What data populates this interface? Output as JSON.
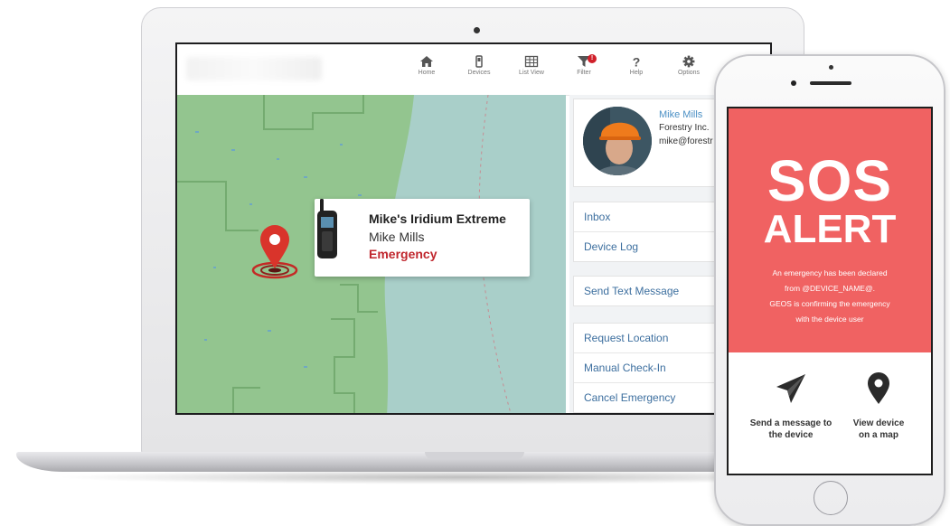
{
  "nav": {
    "items": [
      {
        "label": "Home",
        "icon": "home-icon"
      },
      {
        "label": "Devices",
        "icon": "device-icon"
      },
      {
        "label": "List View",
        "icon": "list-view-icon"
      },
      {
        "label": "Filter",
        "icon": "filter-icon"
      },
      {
        "label": "Help",
        "icon": "help-icon"
      },
      {
        "label": "Options",
        "icon": "gear-icon"
      }
    ],
    "filter_badge": "!"
  },
  "map_popup": {
    "device_name": "Mike's Iridium Extreme",
    "user_name": "Mike Mills",
    "status": "Emergency",
    "status_color": "#c0262d",
    "pin_color": "#d9342b"
  },
  "profile": {
    "name": "Mike Mills",
    "org": "Forestry Inc.",
    "email": "mike@forestr"
  },
  "actions": {
    "group1": [
      "Inbox",
      "Device Log"
    ],
    "group2": [
      "Send Text Message"
    ],
    "group3": [
      "Request Location",
      "Manual Check-In",
      "Cancel Emergency"
    ]
  },
  "phone": {
    "sos": "SOS",
    "alert": "ALERT",
    "message_lines": [
      "An emergency has been declared",
      "from @DEVICE_NAME@.",
      "GEOS is confirming the emergency",
      "with the device user"
    ],
    "action_send_line1": "Send a message to",
    "action_send_line2": "the device",
    "action_view_line1": "View device",
    "action_view_line2": "on a map",
    "alert_color": "#f06262"
  }
}
